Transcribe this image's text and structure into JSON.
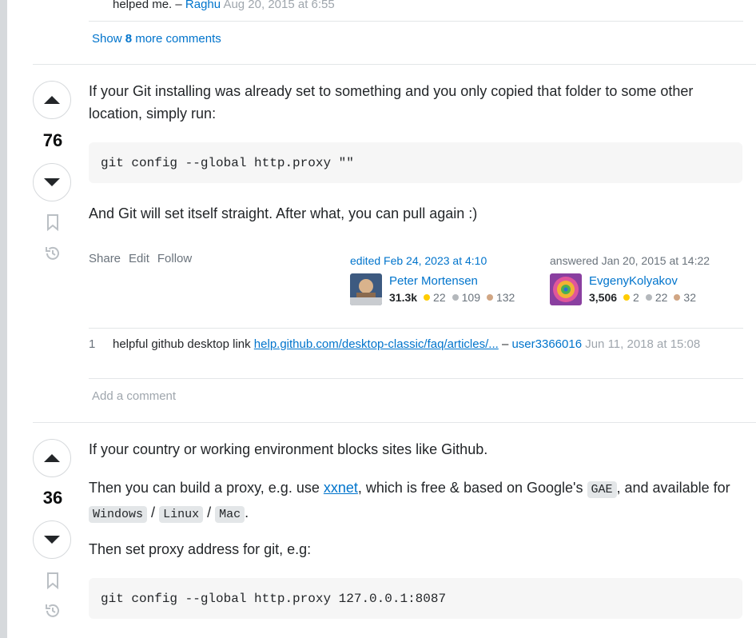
{
  "top_comment": {
    "text": "helped me. –",
    "user": "Raghu",
    "date": "Aug 20, 2015 at 6:55"
  },
  "show_more": {
    "prefix": "Show",
    "count": "8",
    "suffix": "more comments"
  },
  "answer1": {
    "votes": "76",
    "para1": "If your Git installing was already set to something and you only copied that folder to some other location, simply run:",
    "code": "git config --global http.proxy \"\"",
    "para2": "And Git will set itself straight. After what, you can pull again :)",
    "menu": [
      "Share",
      "Edit",
      "Follow"
    ],
    "edited": {
      "action": "edited Feb 24, 2023 at 4:10",
      "name": "Peter Mortensen",
      "rep": "31.3k",
      "gold": "22",
      "silver": "109",
      "bronze": "132"
    },
    "answered": {
      "action": "answered Jan 20, 2015 at 14:22",
      "name": "EvgenyKolyakov",
      "rep": "3,506",
      "gold": "2",
      "silver": "22",
      "bronze": "32"
    },
    "comment": {
      "score": "1",
      "text": "helpful github desktop link",
      "link": "help.github.com/desktop-classic/faq/articles/...",
      "dash": "–",
      "user": "user3366016",
      "date": "Jun 11, 2018 at 15:08"
    },
    "add_comment": "Add a comment"
  },
  "answer2": {
    "votes": "36",
    "para1": "If your country or working environment blocks sites like Github.",
    "para2_a": "Then you can build a proxy, e.g. use",
    "para2_link": "xxnet",
    "para2_b": ", which is free & based on Google's",
    "para2_code1": "GAE",
    "para2_c": ", and available for",
    "code_windows": "Windows",
    "slash": "/",
    "code_linux": "Linux",
    "code_mac": "Mac",
    "para2_end": ".",
    "para3": "Then set proxy address for git, e.g:",
    "code": "git config --global http.proxy 127.0.0.1:8087"
  },
  "icons": {
    "upvote": "upvote-arrow-icon",
    "downvote": "downvote-arrow-icon",
    "bookmark": "bookmark-icon",
    "history": "history-icon"
  }
}
